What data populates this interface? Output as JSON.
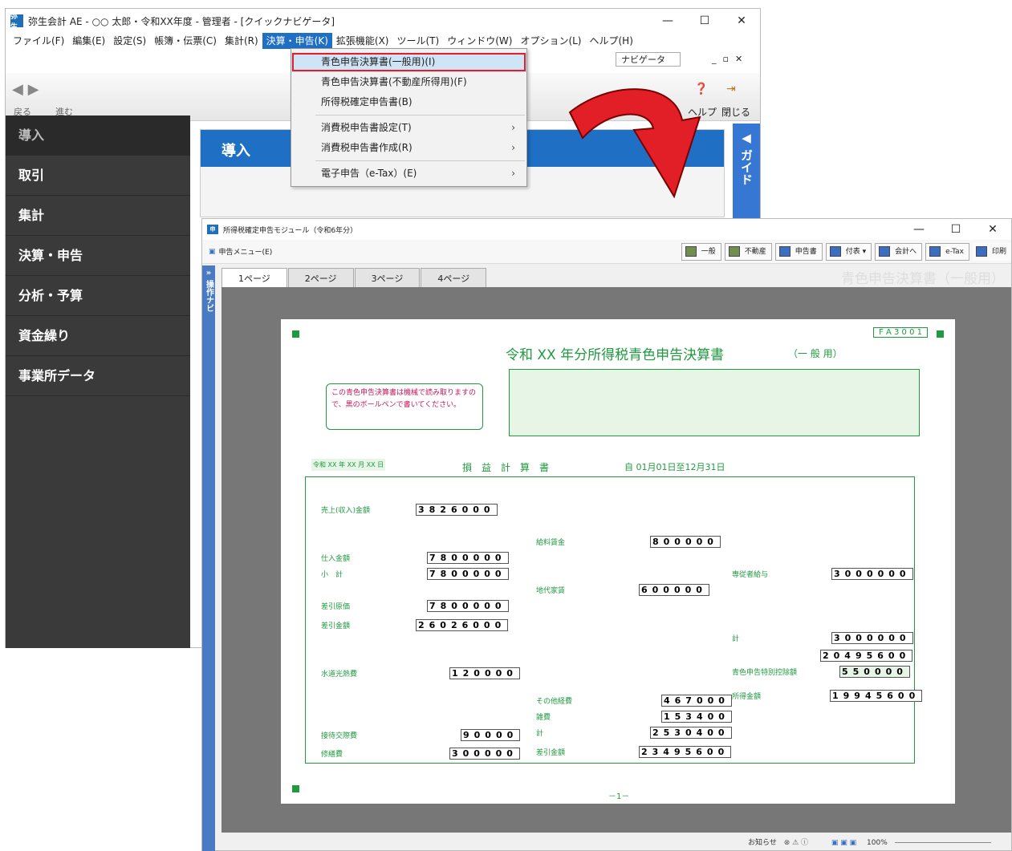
{
  "app_window": {
    "title": "弥生会計 AE - ○○  太郎・令和XX年度 - 管理者 - [クイックナビゲータ]",
    "icon_text": "弥生",
    "menus": [
      "ファイル(F)",
      "編集(E)",
      "設定(S)",
      "帳簿・伝票(C)",
      "集計(R)",
      "決算・申告(K)",
      "拡張機能(X)",
      "ツール(T)",
      "ウィンドウ(W)",
      "オプション(L)",
      "ヘルプ(H)"
    ],
    "navigator_label": "ナビゲータ",
    "back": "戻る",
    "forward": "進む",
    "help": "ヘルプ",
    "close": "閉じる",
    "sidebar": [
      "導入",
      "取引",
      "集計",
      "決算・申告",
      "分析・予算",
      "資金繰り",
      "事業所データ"
    ],
    "content_header": "導入",
    "guide": "ガイド"
  },
  "dropdown": {
    "items": [
      {
        "label": "青色申告決算書(一般用)(I)",
        "sel": true
      },
      {
        "label": "青色申告決算書(不動産所得用)(F)"
      },
      {
        "label": "所得税確定申告書(B)"
      },
      {
        "label": "消費税申告書設定(T)",
        "sub": true
      },
      {
        "label": "消費税申告書作成(R)",
        "sub": true
      },
      {
        "label": "電子申告（e-Tax）(E)",
        "sub": true
      }
    ]
  },
  "module_window": {
    "title": "所得税確定申告モジュール（令和6年分）",
    "menu_button": "申告メニュー(E)",
    "toolbar": [
      "一般",
      "不動産",
      "申告書",
      "付表",
      "会計へ",
      "e-Tax",
      "印刷"
    ],
    "tabs": [
      "1ページ",
      "2ページ",
      "3ページ",
      "4ページ"
    ],
    "right_title": "青色申告決算書（一般用）",
    "nav": "操作ナビ",
    "status": "お知らせ",
    "zoom": "100%"
  },
  "form": {
    "code": "F A 3 0 0 1",
    "title": "令和 XX 年分所得税青色申告決算書",
    "title_sub": "（一 般 用）",
    "note": "この青色申告決算書は機械で読み取りますので、黒のボールペンで書いてください。",
    "pl_title": "損　益　計　算　書",
    "date": "令和 XX 年 XX 月 XX 日",
    "period": "自 01月01日至12月31日",
    "sales_label": "売上(収入)金額",
    "sales": "3826000",
    "purchase_label": "仕入金額",
    "purchase": "7800000",
    "subtotal_label": "小　計",
    "subtotal": "7800000",
    "cogs_label": "差引原価",
    "cogs": "7800000",
    "gross_label": "差引金額",
    "gross": "26026000",
    "utilities_label": "水道光熱費",
    "utilities": "120000",
    "entertain_label": "接待交際費",
    "entertain": "90000",
    "repair_label": "修繕費",
    "repair": "300000",
    "salary_label": "給料賃金",
    "salary": "800000",
    "rent_label": "地代家賃",
    "rent": "600000",
    "other_label": "その他経費",
    "other": "467000",
    "misc_label": "雑費",
    "misc": "153400",
    "total_label": "計",
    "total": "2530400",
    "net_label": "差引金額",
    "net": "23495600",
    "family_label": "専従者給与",
    "family": "3000000",
    "family_total": "3000000",
    "pre_deduction": "20495600",
    "blue_label": "青色申告特別控除額",
    "blue": "550000",
    "income_label": "所得金額",
    "income": "19945600",
    "page_no": "－1－"
  }
}
